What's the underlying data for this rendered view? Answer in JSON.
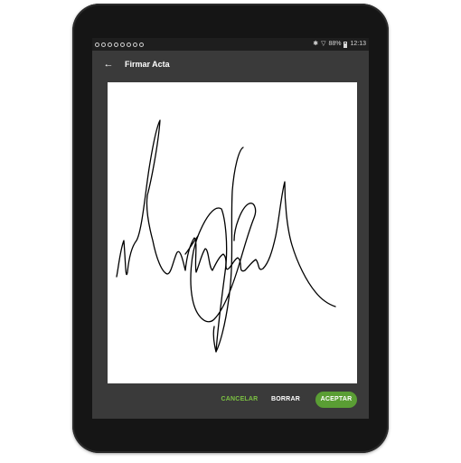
{
  "status_bar": {
    "battery_percent": "88%",
    "time": "12:13"
  },
  "app_bar": {
    "title": "Firmar Acta",
    "back_icon": "arrow-left-icon"
  },
  "actions": {
    "cancel_label": "CANCELAR",
    "clear_label": "BORRAR",
    "accept_label": "ACEPTAR"
  },
  "colors": {
    "accent": "#7cc243",
    "accept_button": "#5a9e34",
    "app_bar": "#3a3a3a",
    "status_bar": "#1e1e1e",
    "device_frame": "#151515"
  }
}
